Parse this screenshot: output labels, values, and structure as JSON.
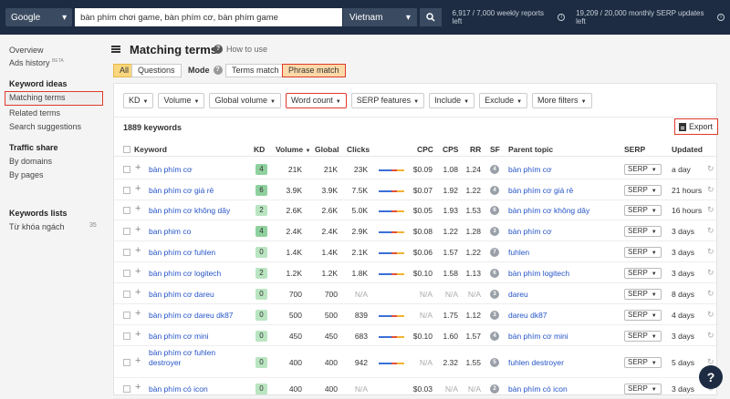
{
  "topbar": {
    "engine": "Google",
    "query": "bàn phím chơi game, bàn phím cơ, bàn phím game",
    "country": "Vietnam",
    "reports": "6,917 / 7,000 weekly reports left",
    "serp_updates": "19,209 / 20,000 monthly SERP updates left"
  },
  "sidebar": {
    "overview": "Overview",
    "ads_history": "Ads history",
    "beta": "BETA",
    "keyword_ideas": "Keyword ideas",
    "matching_terms": "Matching terms",
    "related_terms": "Related terms",
    "search_suggestions": "Search suggestions",
    "traffic_share": "Traffic share",
    "by_domains": "By domains",
    "by_pages": "By pages",
    "keywords_lists": "Keywords lists",
    "list_name": "Từ khóa ngách",
    "list_count": "35"
  },
  "header": {
    "title": "Matching terms",
    "howto": "How to use",
    "all": "All",
    "questions": "Questions",
    "mode": "Mode",
    "terms_match": "Terms match",
    "phrase_match": "Phrase match"
  },
  "filters": [
    "KD",
    "Volume",
    "Global volume",
    "Word count",
    "SERP features",
    "Include",
    "Exclude",
    "More filters"
  ],
  "summary": {
    "count": "1889 keywords",
    "export": "Export"
  },
  "columns": {
    "keyword": "Keyword",
    "kd": "KD",
    "volume": "Volume",
    "global": "Global",
    "clicks": "Clicks",
    "cpc": "CPC",
    "cps": "CPS",
    "rr": "RR",
    "sf": "SF",
    "parent": "Parent topic",
    "serp": "SERP",
    "updated": "Updated"
  },
  "colors": {
    "kd_green": "#8fd19e",
    "kd_lightgreen": "#b9e5c1",
    "accent_red": "#e03a2a",
    "link": "#2554c7"
  },
  "rows": [
    {
      "kw": "bàn phím cơ",
      "kd": "4",
      "vol": "21K",
      "global": "21K",
      "clicks": "23K",
      "cpc": "$0.09",
      "cps": "1.08",
      "rr": "1.24",
      "sf": "4",
      "parent": "bàn phím cơ",
      "serp": "SERP",
      "upd": "a day"
    },
    {
      "kw": "bàn phím cơ giá rẻ",
      "kd": "6",
      "vol": "3.9K",
      "global": "3.9K",
      "clicks": "7.5K",
      "cpc": "$0.07",
      "cps": "1.92",
      "rr": "1.22",
      "sf": "4",
      "parent": "bàn phím cơ giá rẻ",
      "serp": "SERP",
      "upd": "21 hours"
    },
    {
      "kw": "bàn phím cơ không dây",
      "kd": "2",
      "vol": "2.6K",
      "global": "2.6K",
      "clicks": "5.0K",
      "cpc": "$0.05",
      "cps": "1.93",
      "rr": "1.53",
      "sf": "6",
      "parent": "bàn phím cơ không dây",
      "serp": "SERP",
      "upd": "16 hours"
    },
    {
      "kw": "ban phim co",
      "kd": "4",
      "vol": "2.4K",
      "global": "2.4K",
      "clicks": "2.9K",
      "cpc": "$0.08",
      "cps": "1.22",
      "rr": "1.28",
      "sf": "3",
      "parent": "bàn phím cơ",
      "serp": "SERP",
      "upd": "3 days"
    },
    {
      "kw": "bàn phím cơ fuhlen",
      "kd": "0",
      "vol": "1.4K",
      "global": "1.4K",
      "clicks": "2.1K",
      "cpc": "$0.06",
      "cps": "1.57",
      "rr": "1.22",
      "sf": "7",
      "parent": "fuhlen",
      "serp": "SERP",
      "upd": "3 days"
    },
    {
      "kw": "bàn phím cơ logitech",
      "kd": "2",
      "vol": "1.2K",
      "global": "1.2K",
      "clicks": "1.8K",
      "cpc": "$0.10",
      "cps": "1.58",
      "rr": "1.13",
      "sf": "6",
      "parent": "bàn phím logitech",
      "serp": "SERP",
      "upd": "3 days"
    },
    {
      "kw": "bàn phím cơ dareu",
      "kd": "0",
      "vol": "700",
      "global": "700",
      "clicks": "N/A",
      "cpc": "N/A",
      "cps": "N/A",
      "rr": "N/A",
      "sf": "3",
      "parent": "dareu",
      "serp": "SERP",
      "upd": "8 days"
    },
    {
      "kw": "bàn phím cơ dareu dk87",
      "kd": "0",
      "vol": "500",
      "global": "500",
      "clicks": "839",
      "cpc": "N/A",
      "cps": "1.75",
      "rr": "1.12",
      "sf": "3",
      "parent": "dareu dk87",
      "serp": "SERP",
      "upd": "4 days"
    },
    {
      "kw": "bàn phím cơ mini",
      "kd": "0",
      "vol": "450",
      "global": "450",
      "clicks": "683",
      "cpc": "$0.10",
      "cps": "1.60",
      "rr": "1.57",
      "sf": "4",
      "parent": "bàn phím cơ mini",
      "serp": "SERP",
      "upd": "3 days"
    },
    {
      "kw": "bàn phím cơ fuhlen destroyer",
      "kd": "0",
      "vol": "400",
      "global": "400",
      "clicks": "942",
      "cpc": "N/A",
      "cps": "2.32",
      "rr": "1.55",
      "sf": "5",
      "parent": "fuhlen destroyer",
      "serp": "SERP",
      "upd": "5 days"
    },
    {
      "kw": "bàn phím có icon",
      "kd": "0",
      "vol": "400",
      "global": "400",
      "clicks": "N/A",
      "cpc": "$0.03",
      "cps": "N/A",
      "rr": "N/A",
      "sf": "2",
      "parent": "bàn phím có icon",
      "serp": "SERP",
      "upd": "3 days"
    }
  ],
  "help": "?"
}
